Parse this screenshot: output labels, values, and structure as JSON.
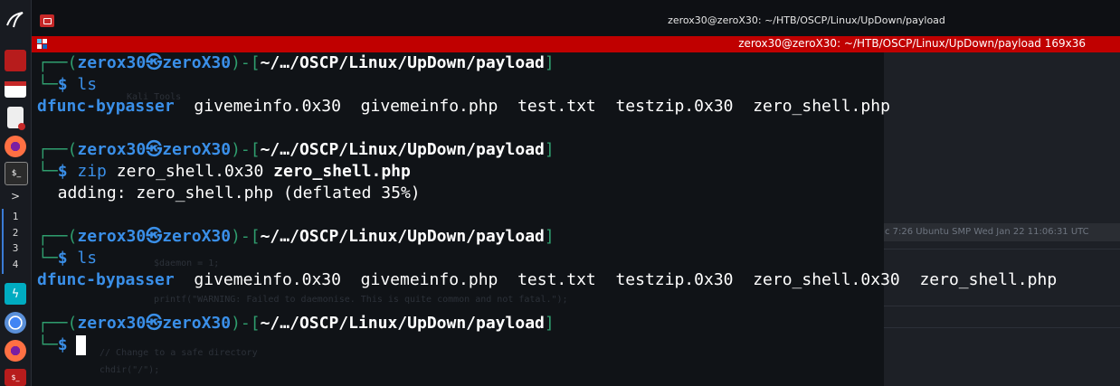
{
  "window": {
    "title": "zerox30@zeroX30: ~/HTB/OSCP/Linux/UpDown/payload",
    "tab_title": "zerox30@zeroX30: ~/HTB/OSCP/Linux/UpDown/payload 169x36"
  },
  "dock": {
    "workspaces": [
      "1",
      "2",
      "3",
      "4"
    ]
  },
  "prompt": {
    "user": "zerox30",
    "host": "zeroX30",
    "symbol": "㉿",
    "path": "~/…/OSCP/Linux/UpDown/payload",
    "dollar": "$"
  },
  "blocks": [
    {
      "command": "ls",
      "output_dir": "dfunc-bypasser",
      "output_files": [
        "givemeinfo.0x30",
        "givemeinfo.php",
        "test.txt",
        "testzip.0x30",
        "zero_shell.php"
      ]
    },
    {
      "command": "zip",
      "args": "zero_shell.0x30",
      "args_bold": "zero_shell.php",
      "output_text": "  adding: zero_shell.php (deflated 35%)"
    },
    {
      "command": "ls",
      "output_dir": "dfunc-bypasser",
      "output_files": [
        "givemeinfo.0x30",
        "givemeinfo.php",
        "test.txt",
        "testzip.0x30",
        "zero_shell.0x30",
        "zero_shell.php"
      ]
    }
  ],
  "background": {
    "status_strip": "c 7:26 Ubuntu SMP Wed Jan 22 11:06:31 UTC",
    "ghost_lines": [
      "Kali Tools",
      "$daemon = 1;",
      "printf(\"WARNING: Failed to daemonise.  This is quite common and not fatal.\");",
      "// Change to a safe directory",
      "chdir(\"/\");"
    ]
  },
  "colors": {
    "accent_red": "#c00000",
    "prompt_blue": "#3a8fe8",
    "box_green": "#2f9e6e"
  }
}
